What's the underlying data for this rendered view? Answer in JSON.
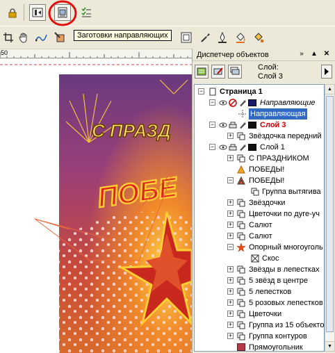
{
  "toolbar": {
    "tooltip": "Заготовки направляющих"
  },
  "ruler": {
    "label": "50"
  },
  "docker": {
    "title": "Диспетчер объектов",
    "layer_caption": "Слой:",
    "layer_name": "Слой 3"
  },
  "tree": {
    "page": "Страница 1",
    "guides_layer": "Направляющие",
    "guide_item": "Направляющая",
    "layer3": "Слой 3",
    "star_front": "Звёздочка передний",
    "layer1": "Слой 1",
    "items": [
      "С ПРАЗДНИКОМ",
      "ПОБЕДЫ!",
      "ПОБЕДЫ!",
      "Группа вытягива",
      "Звёздочки",
      "Цветочки по дуге-уч",
      "Салют",
      "Салют",
      "Опорный многоуголь",
      "Скос",
      "Звёзды в лепестках",
      "5 звёзд в центре",
      "5 лепестков",
      "5 розовых лепестков",
      "Цветочки",
      "Группа из 15 объекто",
      "Группа контуров",
      "Прямоугольник"
    ]
  },
  "colors": {
    "selection": "#316ac5",
    "layer3_red": "#cc0000",
    "highlight_circle": "#e01010"
  }
}
